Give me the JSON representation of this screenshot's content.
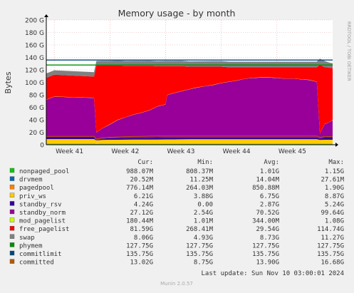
{
  "chart_data": {
    "type": "area",
    "title": "Memory usage - by month",
    "ylabel": "Bytes",
    "xlabel": "",
    "side_label": "RRDTOOL / TOBI OETIKER",
    "ylim": [
      0,
      200
    ],
    "y_unit": "G",
    "y_ticks": [
      "0",
      "20 G",
      "40 G",
      "60 G",
      "80 G",
      "100 G",
      "120 G",
      "140 G",
      "160 G",
      "180 G",
      "200 G"
    ],
    "x_ticks": [
      "Week 41",
      "Week 42",
      "Week 43",
      "Week 44",
      "Week 45"
    ],
    "x_range_days": [
      0,
      36
    ],
    "x_tick_days": [
      1,
      8,
      15,
      22,
      29
    ],
    "grid": true,
    "legend_headers": [
      "Cur:",
      "Min:",
      "Avg:",
      "Max:"
    ],
    "legend": [
      {
        "name": "nonpaged_pool",
        "color": "#00cc00",
        "cur": "988.07M",
        "min": "808.37M",
        "avg": "1.01G",
        "max": "1.15G"
      },
      {
        "name": "drvmem",
        "color": "#0066b3",
        "cur": "20.52M",
        "min": "11.25M",
        "avg": "14.04M",
        "max": "27.61M"
      },
      {
        "name": "pagedpool",
        "color": "#ff8000",
        "cur": "776.14M",
        "min": "264.03M",
        "avg": "850.88M",
        "max": "1.90G"
      },
      {
        "name": "priv_ws",
        "color": "#ffcc00",
        "cur": "6.21G",
        "min": "3.88G",
        "avg": "6.75G",
        "max": "8.87G"
      },
      {
        "name": "standby_rsv",
        "color": "#330099",
        "cur": "4.24G",
        "min": "0.00",
        "avg": "2.87G",
        "max": "5.24G"
      },
      {
        "name": "standby_norm",
        "color": "#990099",
        "cur": "27.12G",
        "min": "2.54G",
        "avg": "70.52G",
        "max": "99.64G"
      },
      {
        "name": "mod_pagelist",
        "color": "#ccff00",
        "cur": "180.44M",
        "min": "1.01M",
        "avg": "344.00M",
        "max": "1.08G"
      },
      {
        "name": "free_pagelist",
        "color": "#ff0000",
        "cur": "81.59G",
        "min": "268.41M",
        "avg": "29.54G",
        "max": "114.74G"
      },
      {
        "name": "swap",
        "color": "#808080",
        "cur": "8.06G",
        "min": "4.93G",
        "avg": "8.73G",
        "max": "11.27G"
      },
      {
        "name": "phymem",
        "color": "#008f00",
        "cur": "127.75G",
        "min": "127.75G",
        "avg": "127.75G",
        "max": "127.75G"
      },
      {
        "name": "commitlimit",
        "color": "#00487d",
        "cur": "135.75G",
        "min": "135.75G",
        "avg": "135.75G",
        "max": "135.75G"
      },
      {
        "name": "committed",
        "color": "#b35a00",
        "cur": "13.02G",
        "min": "8.75G",
        "avg": "13.90G",
        "max": "16.68G"
      }
    ],
    "x_days": [
      0,
      1,
      6,
      6.3,
      7,
      8,
      9,
      10,
      11,
      12,
      13,
      14,
      15,
      15.2,
      16,
      17,
      18,
      19,
      20,
      21,
      22,
      23,
      24,
      25,
      26,
      27,
      28,
      29,
      30,
      31,
      32,
      33,
      34,
      34.4,
      35,
      35.6,
      36
    ],
    "stack_order": [
      "nonpaged_pool",
      "drvmem",
      "pagedpool",
      "priv_ws",
      "standby_rsv",
      "standby_norm",
      "mod_pagelist",
      "free_pagelist",
      "swap"
    ],
    "stacks": {
      "nonpaged_pool": [
        1.0,
        1.0,
        1.0,
        1.0,
        1.0,
        1.0,
        1.0,
        1.0,
        1.0,
        1.0,
        1.0,
        1.0,
        1.0,
        1.0,
        1.0,
        1.0,
        1.0,
        1.0,
        1.0,
        1.0,
        1.0,
        1.0,
        1.0,
        1.0,
        1.0,
        1.0,
        1.0,
        1.0,
        1.0,
        1.0,
        1.0,
        1.0,
        1.0,
        1.0,
        1.0,
        1.0,
        1.0
      ],
      "drvmem": [
        0.0,
        0.0,
        0.0,
        0.0,
        0.0,
        0.0,
        0.0,
        0.0,
        0.0,
        0.0,
        0.0,
        0.0,
        0.0,
        0.0,
        0.0,
        0.0,
        0.0,
        0.0,
        0.0,
        0.0,
        0.0,
        0.0,
        0.0,
        0.0,
        0.0,
        0.0,
        0.0,
        0.0,
        0.0,
        0.0,
        0.0,
        0.0,
        0.0,
        0.0,
        0.0,
        0.0,
        0.0
      ],
      "pagedpool": [
        1.0,
        1.0,
        1.0,
        0.5,
        0.8,
        0.8,
        0.8,
        0.8,
        0.8,
        0.8,
        0.8,
        0.8,
        0.8,
        0.8,
        0.8,
        0.8,
        0.8,
        0.8,
        0.8,
        0.8,
        0.8,
        0.8,
        0.8,
        0.8,
        0.8,
        0.8,
        0.8,
        0.8,
        0.8,
        0.8,
        0.8,
        0.8,
        0.8,
        0.8,
        0.8,
        0.8,
        0.8
      ],
      "priv_ws": [
        7.0,
        7.0,
        7.0,
        5.5,
        6.0,
        6.2,
        6.2,
        6.3,
        6.5,
        6.5,
        6.5,
        6.6,
        6.8,
        6.8,
        6.8,
        6.9,
        7.0,
        7.0,
        7.0,
        7.0,
        7.0,
        7.0,
        7.0,
        7.0,
        7.0,
        7.0,
        7.0,
        7.0,
        7.0,
        7.0,
        7.0,
        7.0,
        7.0,
        6.0,
        6.2,
        6.2,
        6.2
      ],
      "standby_rsv": [
        3.0,
        3.0,
        3.0,
        0.5,
        2.0,
        2.5,
        2.8,
        3.0,
        3.0,
        3.0,
        3.0,
        3.0,
        3.0,
        3.0,
        3.0,
        3.0,
        3.0,
        3.0,
        3.0,
        3.0,
        3.0,
        3.0,
        3.0,
        3.0,
        3.0,
        3.0,
        3.0,
        3.0,
        3.0,
        3.0,
        3.0,
        3.0,
        3.0,
        2.0,
        4.0,
        4.2,
        4.2
      ],
      "standby_norm": [
        60,
        65,
        63,
        12,
        16,
        22,
        29,
        33,
        37,
        40,
        44,
        50,
        53,
        68,
        71,
        74,
        77,
        80,
        82,
        84,
        87,
        89,
        91,
        94,
        95,
        96,
        96,
        95,
        94,
        94,
        93,
        92,
        89,
        8,
        21,
        24,
        27
      ],
      "mod_pagelist": [
        0.3,
        0.3,
        0.3,
        0.3,
        0.3,
        0.3,
        0.3,
        0.3,
        0.3,
        0.3,
        0.3,
        0.3,
        0.3,
        0.3,
        0.3,
        0.3,
        0.3,
        0.3,
        0.3,
        0.3,
        0.3,
        0.3,
        0.3,
        0.3,
        0.3,
        0.3,
        0.3,
        0.3,
        0.3,
        0.3,
        0.3,
        0.3,
        0.3,
        0.3,
        0.3,
        0.3,
        0.3
      ],
      "free_pagelist": [
        35,
        35,
        34,
        107,
        101,
        94,
        87,
        82,
        78,
        75,
        71,
        64,
        61,
        46,
        43,
        40,
        36,
        33,
        31,
        29,
        26,
        23,
        21,
        18,
        17,
        16,
        16,
        17,
        18,
        18,
        19,
        20,
        23,
        110,
        91,
        87,
        83
      ],
      "swap": [
        7.0,
        7.0,
        7.0,
        7.5,
        7.5,
        7.8,
        8.0,
        8.0,
        8.0,
        8.0,
        8.2,
        8.5,
        8.5,
        8.5,
        8.5,
        8.5,
        8.5,
        8.6,
        8.7,
        8.8,
        9.0,
        9.0,
        9.0,
        9.0,
        9.0,
        9.0,
        9.0,
        9.0,
        9.0,
        9.0,
        9.0,
        9.0,
        9.0,
        10.0,
        10.0,
        8.0,
        8.0
      ]
    },
    "lines": {
      "phymem": 127.75,
      "commitlimit": 135.75,
      "committed": [
        13.5,
        13.5,
        13.5,
        9.0,
        11.0,
        12.0,
        12.5,
        13.0,
        13.2,
        13.5,
        13.8,
        14.0,
        14.0,
        14.0,
        14.0,
        14.0,
        14.0,
        14.0,
        14.0,
        14.0,
        14.0,
        14.0,
        14.0,
        14.0,
        14.0,
        14.0,
        14.0,
        14.0,
        14.0,
        14.0,
        14.0,
        14.0,
        14.0,
        12.0,
        13.0,
        13.0,
        13.0
      ]
    },
    "footer": "Last update: Sun Nov 10 03:00:01 2024",
    "generator": "Munin 2.0.57"
  }
}
